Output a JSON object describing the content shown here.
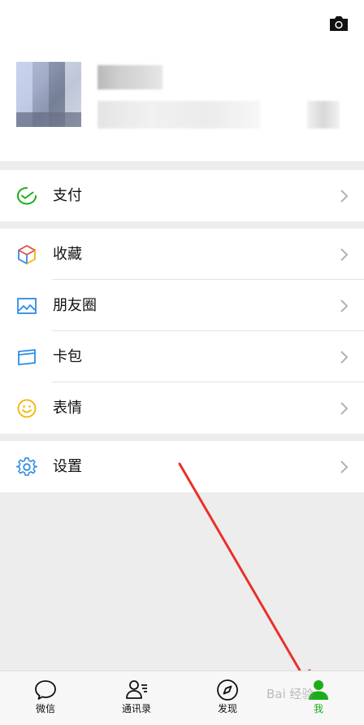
{
  "profile": {
    "name": "",
    "wechat_id": ""
  },
  "menu": {
    "pay": {
      "label": "支付"
    },
    "favorites": {
      "label": "收藏"
    },
    "moments": {
      "label": "朋友圈"
    },
    "cards": {
      "label": "卡包"
    },
    "stickers": {
      "label": "表情"
    },
    "settings": {
      "label": "设置"
    }
  },
  "tabbar": {
    "tabs": [
      {
        "label": "微信",
        "icon": "chat-bubble-icon"
      },
      {
        "label": "通讯录",
        "icon": "contacts-icon"
      },
      {
        "label": "发现",
        "icon": "compass-icon"
      },
      {
        "label": "我",
        "icon": "person-icon",
        "active": true
      }
    ]
  },
  "watermark": "Bai 经验",
  "colors": {
    "accent_green": "#1aad19",
    "arrow_red": "#e8312a",
    "background": "#ededed"
  }
}
